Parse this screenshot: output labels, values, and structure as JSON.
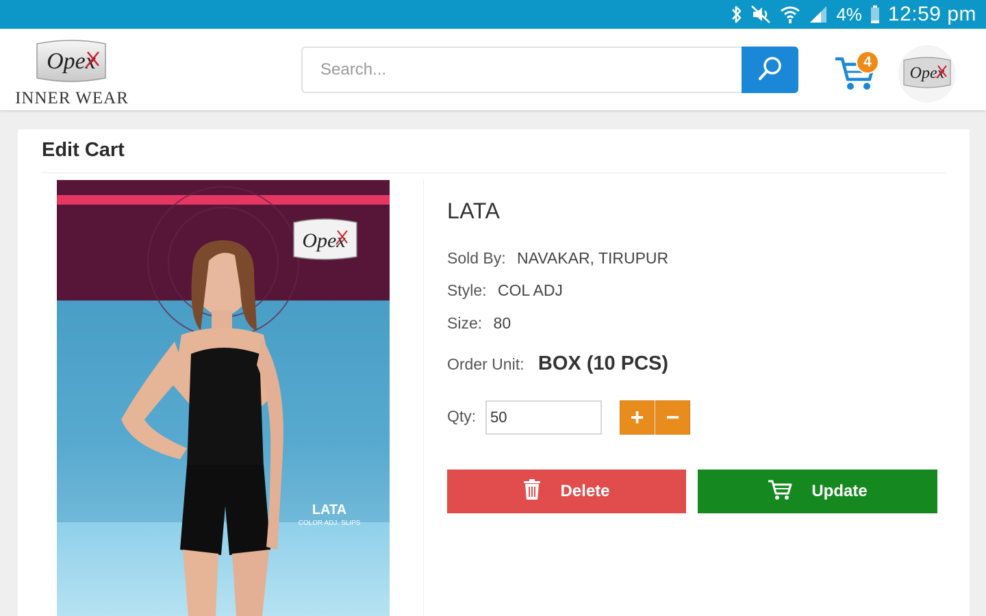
{
  "status_bar": {
    "battery": "4%",
    "time": "12:59 pm",
    "icons": [
      "bluetooth-icon",
      "mute-icon",
      "wifi-icon",
      "signal-icon",
      "battery-icon"
    ]
  },
  "header": {
    "logo_mark": "Opex",
    "logo_text": "INNER WEAR",
    "search_placeholder": "Search...",
    "cart_count": "4",
    "colors": {
      "status_bar": "#0d96c8",
      "search_button": "#1a88d6",
      "cart_badge": "#f08a17"
    }
  },
  "page": {
    "title": "Edit Cart"
  },
  "product": {
    "name": "LATA",
    "image_brand": "Opex",
    "image_label": "LATA",
    "image_sublabel": "COLOR ADJ. SLIPS",
    "sold_by_label": "Sold By:",
    "sold_by": "NAVAKAR, TIRUPUR",
    "style_label": "Style:",
    "style": "COL ADJ",
    "size_label": "Size:",
    "size": "80",
    "order_unit_label": "Order Unit:",
    "order_unit": "BOX (10 PCS)",
    "qty_label": "Qty:",
    "qty": "50",
    "plus": "+",
    "minus": "−"
  },
  "actions": {
    "delete_label": "Delete",
    "update_label": "Update",
    "colors": {
      "delete": "#e14d4d",
      "update": "#15891f",
      "qty_buttons": "#e88d1d"
    }
  }
}
